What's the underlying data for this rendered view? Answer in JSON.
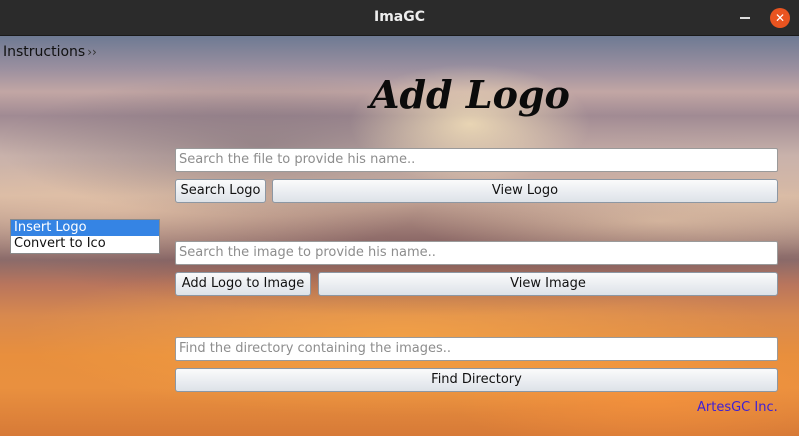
{
  "window": {
    "title": "ImaGC",
    "close_glyph": "✕"
  },
  "menu": {
    "instructions_label": "Instructions",
    "instructions_chevron": "››"
  },
  "heading": "Add Logo",
  "mode_list": {
    "items": [
      {
        "label": "Insert Logo",
        "selected": true
      },
      {
        "label": "Convert to Ico",
        "selected": false
      }
    ]
  },
  "logo_section": {
    "file_field_placeholder": "Search the file to provide his name..",
    "search_button": "Search Logo",
    "view_button": "View Logo"
  },
  "image_section": {
    "image_field_placeholder": "Search the image to provide his name..",
    "add_button": "Add Logo to Image",
    "view_button": "View Image"
  },
  "directory_section": {
    "directory_field_placeholder": "Find the directory containing the images..",
    "find_button": "Find Directory"
  },
  "credit": "ArtesGC Inc.",
  "colors": {
    "titlebar": "#2b2b2b",
    "close_button": "#e95420",
    "selection": "#3584e4",
    "credit_text": "#3d1fd6"
  },
  "icons": {
    "minimize": "minimize-icon",
    "close": "close-icon",
    "chevron": "chevron-right-icon"
  }
}
